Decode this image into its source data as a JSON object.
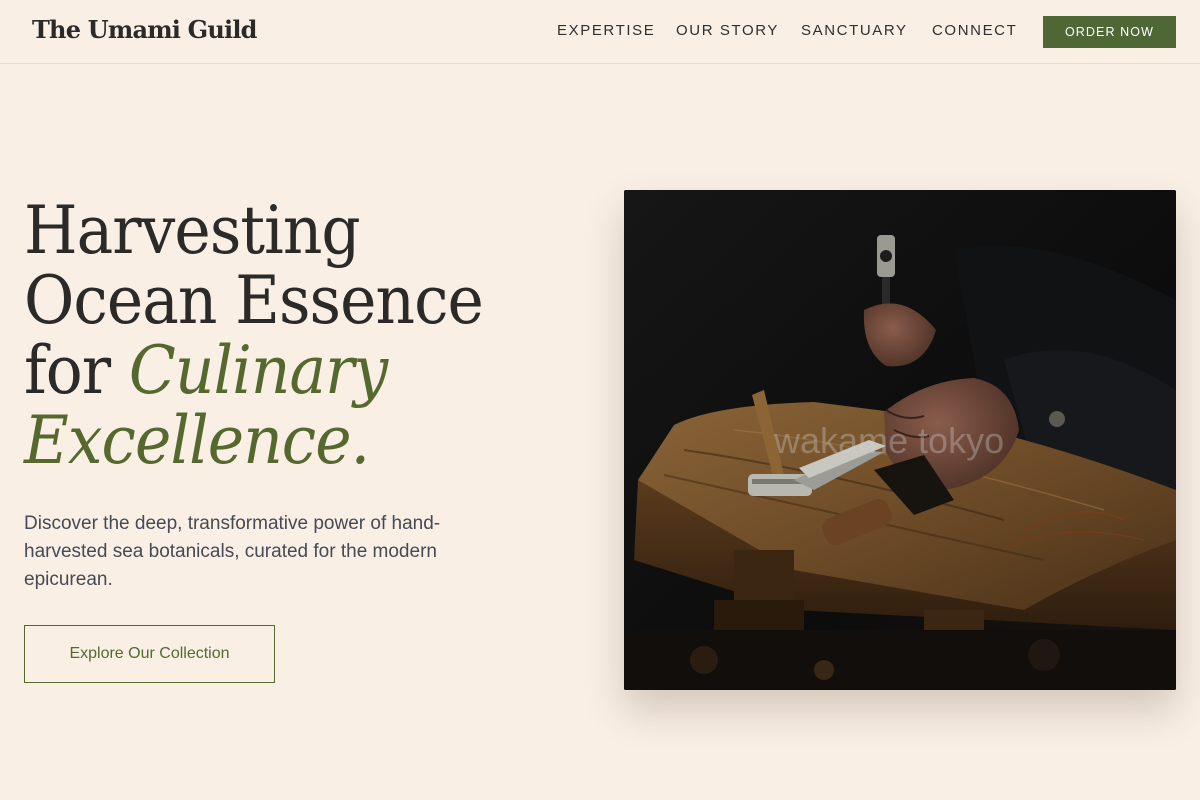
{
  "header": {
    "logo": "The Umami Guild",
    "nav": [
      {
        "label": "EXPERTISE"
      },
      {
        "label": "OUR STORY"
      },
      {
        "label": "SANCTUARY"
      },
      {
        "label": "CONNECT"
      }
    ],
    "order_button": "ORDER NOW"
  },
  "hero": {
    "title_line1": "Harvesting",
    "title_line2": "Ocean Essence",
    "title_line3_plain": "for ",
    "title_line3_accent": "Culinary",
    "title_line4_accent": "Excellence.",
    "subtitle": "Discover the deep, transformative power of hand-harvested sea botanicals, curated for the modern epicurean.",
    "cta_label": "Explore Our Collection",
    "image_watermark": "wakame tokyo"
  },
  "colors": {
    "background": "#f9efe5",
    "accent_green": "#55692f",
    "button_green": "#4f6635",
    "text_dark": "#2b2a28"
  }
}
